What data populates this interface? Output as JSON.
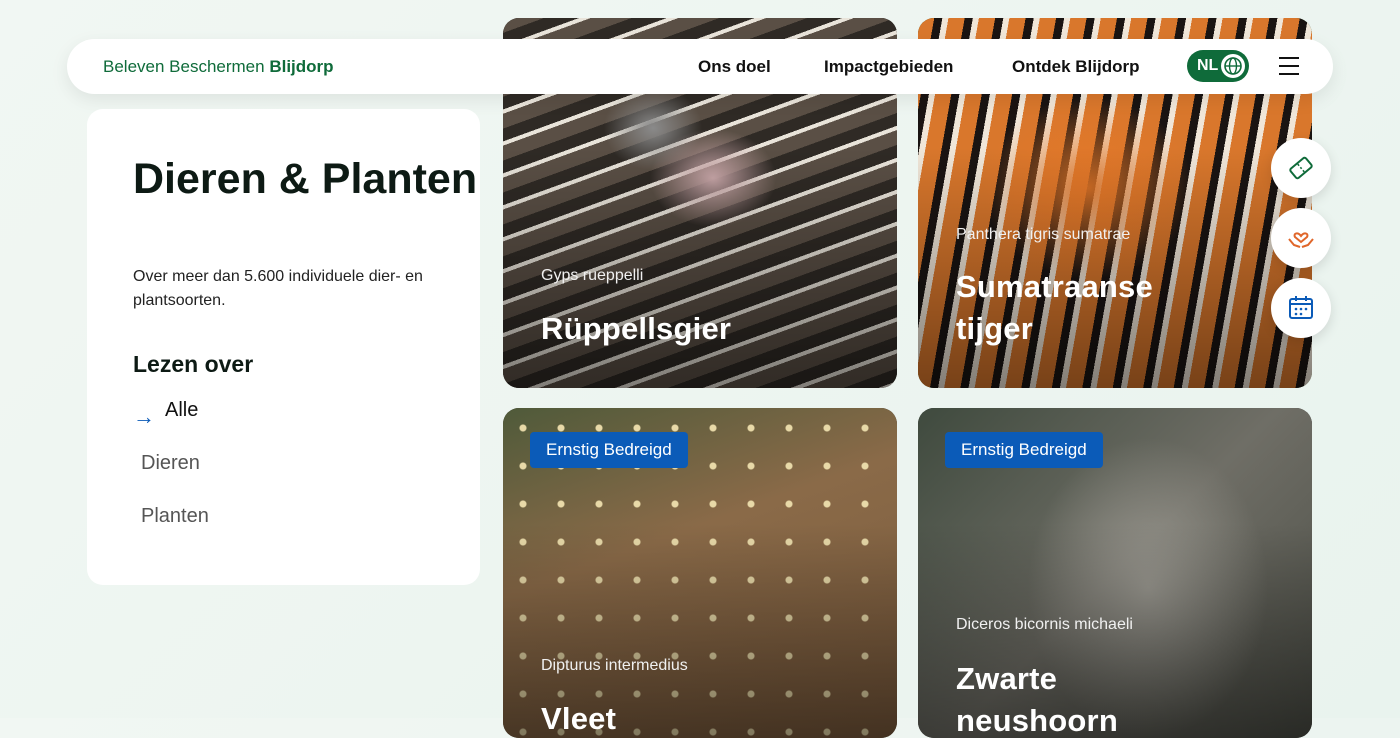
{
  "header": {
    "brand_prefix": "Beleven Beschermen",
    "brand_name": "Blijdorp",
    "nav": [
      "Ons doel",
      "Impactgebieden",
      "Ontdek Blijdorp"
    ],
    "language": "NL"
  },
  "sidebar": {
    "title": "Dieren & Planten",
    "description": "Over meer dan 5.600 individuele dier- en plantsoorten.",
    "section_title": "Lezen over",
    "filters": [
      "Alle",
      "Dieren",
      "Planten"
    ],
    "active_filter": "Alle"
  },
  "cards": [
    {
      "latin": "Gyps rueppelli",
      "name": "Rüppellsgier",
      "badge": ""
    },
    {
      "latin": "Panthera tigris sumatrae",
      "name": "Sumatraanse tijger",
      "badge": ""
    },
    {
      "latin": "Dipturus intermedius",
      "name": "Vleet",
      "badge": "Ernstig Bedreigd"
    },
    {
      "latin": "Diceros bicornis michaeli",
      "name": "Zwarte neushoorn",
      "badge": "Ernstig Bedreigd"
    }
  ],
  "fabs": [
    {
      "icon": "ticket-icon"
    },
    {
      "icon": "heart-hands-icon"
    },
    {
      "icon": "calendar-icon"
    }
  ],
  "colors": {
    "brand_green": "#0f6b3a",
    "badge_blue": "#0b5bb8",
    "accent_orange": "#e0662a"
  }
}
